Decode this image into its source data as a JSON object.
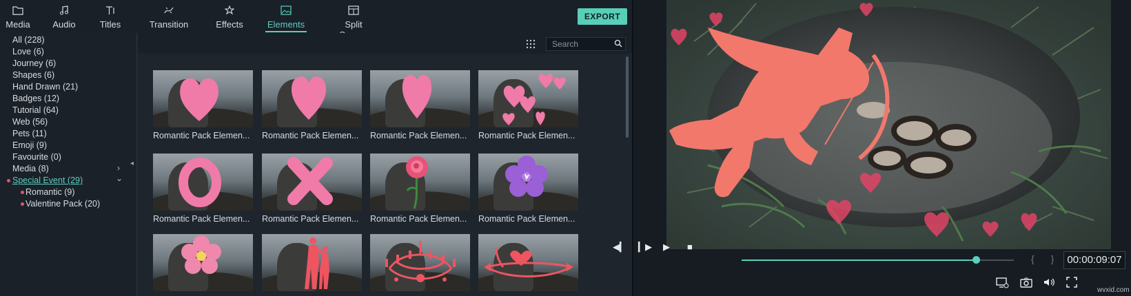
{
  "tabs": [
    {
      "label": "Media",
      "icon": "folder-icon"
    },
    {
      "label": "Audio",
      "icon": "music-note-icon"
    },
    {
      "label": "Titles",
      "icon": "text-icon"
    },
    {
      "label": "Transition",
      "icon": "transition-icon"
    },
    {
      "label": "Effects",
      "icon": "effects-icon"
    },
    {
      "label": "Elements",
      "icon": "image-icon",
      "active": true
    },
    {
      "label": "Split Screen",
      "icon": "split-screen-icon"
    }
  ],
  "export_label": "EXPORT",
  "categories": [
    "All (228)",
    "Love (6)",
    "Journey (6)",
    "Shapes (6)",
    "Hand Drawn (21)",
    "Badges (12)",
    "Tutorial (64)",
    "Web (56)",
    "Pets (11)",
    "Emoji (9)",
    "Favourite (0)",
    "Media (8)",
    "Special Event (29)"
  ],
  "subcategories": [
    "Romantic (9)",
    "Valentine Pack (20)"
  ],
  "search": {
    "placeholder": "Search"
  },
  "elements": [
    {
      "caption": "Romantic Pack Elemen..."
    },
    {
      "caption": "Romantic Pack Elemen..."
    },
    {
      "caption": "Romantic Pack Elemen..."
    },
    {
      "caption": "Romantic Pack Elemen..."
    },
    {
      "caption": "Romantic Pack Elemen..."
    },
    {
      "caption": "Romantic Pack Elemen..."
    },
    {
      "caption": "Romantic Pack Elemen..."
    },
    {
      "caption": "Romantic Pack Elemen..."
    },
    {
      "caption": ""
    },
    {
      "caption": ""
    },
    {
      "caption": ""
    },
    {
      "caption": ""
    }
  ],
  "player": {
    "timecode": "00:00:09:07",
    "progress": 0.86,
    "braces": "{ }"
  },
  "watermark": "wvxid.com",
  "colors": {
    "accent": "#5ad0c0",
    "element_pink": "#f07aa8",
    "cupid": "#f2786c"
  }
}
